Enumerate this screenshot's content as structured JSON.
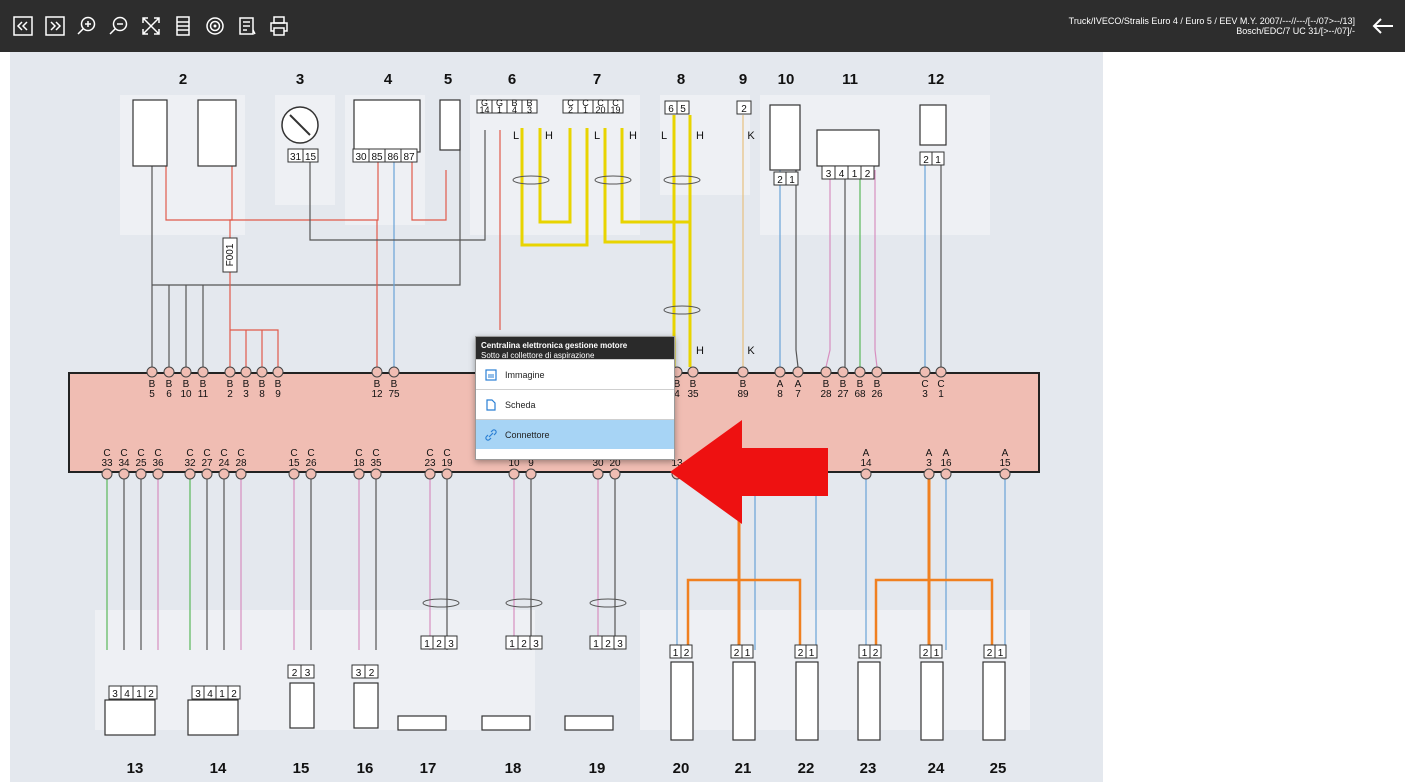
{
  "toolbar": {
    "buttons": [
      "first-page",
      "last-page",
      "zoom-in",
      "zoom-out",
      "fit-screen",
      "list",
      "circuit",
      "notes",
      "print"
    ],
    "vehicle_line1": "Truck/IVECO/Stralis Euro 4 / Euro 5 / EEV M.Y. 2007/---//---/[--/07>--/13]",
    "vehicle_line2": "Bosch/EDC/7 UC 31/[>--/07]/-"
  },
  "diagram": {
    "top_numbers": [
      "2",
      "3",
      "4",
      "5",
      "6",
      "7",
      "8",
      "9",
      "10",
      "11",
      "12"
    ],
    "bottom_numbers": [
      "13",
      "14",
      "15",
      "16",
      "17",
      "18",
      "19",
      "20",
      "21",
      "22",
      "23",
      "24",
      "25"
    ],
    "fuse_label": "F001",
    "wire_letters": [
      "L",
      "H",
      "L",
      "H",
      "L",
      "H",
      "K",
      "H",
      "K"
    ],
    "top_pins": [
      {
        "top": "B",
        "bot": "5"
      },
      {
        "top": "B",
        "bot": "6"
      },
      {
        "top": "B",
        "bot": "10"
      },
      {
        "top": "B",
        "bot": "11"
      },
      {
        "top": "B",
        "bot": "2"
      },
      {
        "top": "B",
        "bot": "3"
      },
      {
        "top": "B",
        "bot": "8"
      },
      {
        "top": "B",
        "bot": "9"
      },
      {
        "top": "B",
        "bot": "12"
      },
      {
        "top": "B",
        "bot": "75"
      },
      {
        "top": "B",
        "bot": "4"
      },
      {
        "top": "B",
        "bot": "35"
      },
      {
        "top": "B",
        "bot": "89"
      },
      {
        "top": "A",
        "bot": "8"
      },
      {
        "top": "A",
        "bot": "7"
      },
      {
        "top": "B",
        "bot": "28"
      },
      {
        "top": "B",
        "bot": "27"
      },
      {
        "top": "B",
        "bot": "68"
      },
      {
        "top": "B",
        "bot": "26"
      },
      {
        "top": "C",
        "bot": "3"
      },
      {
        "top": "C",
        "bot": "1"
      }
    ],
    "bottom_pins": [
      {
        "top": "C",
        "bot": "33"
      },
      {
        "top": "C",
        "bot": "34"
      },
      {
        "top": "C",
        "bot": "25"
      },
      {
        "top": "C",
        "bot": "36"
      },
      {
        "top": "C",
        "bot": "32"
      },
      {
        "top": "C",
        "bot": "27"
      },
      {
        "top": "C",
        "bot": "24"
      },
      {
        "top": "C",
        "bot": "28"
      },
      {
        "top": "C",
        "bot": "15"
      },
      {
        "top": "C",
        "bot": "26"
      },
      {
        "top": "C",
        "bot": "18"
      },
      {
        "top": "C",
        "bot": "35"
      },
      {
        "top": "C",
        "bot": "23"
      },
      {
        "top": "C",
        "bot": "19"
      },
      {
        "top": "",
        "bot": "10"
      },
      {
        "top": "",
        "bot": "9"
      },
      {
        "top": "",
        "bot": "30"
      },
      {
        "top": "",
        "bot": "20"
      },
      {
        "top": "",
        "bot": "13"
      },
      {
        "top": "A",
        "bot": "14"
      },
      {
        "top": "A",
        "bot": "3"
      },
      {
        "top": "A",
        "bot": "16"
      },
      {
        "top": "A",
        "bot": "15"
      }
    ],
    "connector_top_labels": {
      "c3": [
        "31",
        "15"
      ],
      "c4": [
        "30",
        "85",
        "86",
        "87"
      ],
      "c6": [
        "G 14",
        "G 1",
        "B 4",
        "B 3"
      ],
      "c7": [
        "C 2",
        "C 1",
        "C 20",
        "C 19"
      ],
      "c8": [
        "6",
        "5"
      ],
      "c9": [
        "2"
      ],
      "c10": [
        "2",
        "1"
      ],
      "c11": [
        "3",
        "4",
        "1",
        "2"
      ],
      "c12": [
        "2",
        "1"
      ]
    },
    "connector_bottom_labels": {
      "c13": [
        "3",
        "4",
        "1",
        "2"
      ],
      "c14": [
        "3",
        "4",
        "1",
        "2"
      ],
      "c15": [
        "2",
        "3"
      ],
      "c16": [
        "3",
        "2"
      ],
      "c17": [
        "1",
        "2",
        "3"
      ],
      "c18": [
        "1",
        "2",
        "3"
      ],
      "c19": [
        "1",
        "2",
        "3"
      ],
      "c20": [
        "1",
        "2"
      ],
      "c21": [
        "2",
        "1"
      ],
      "c22": [
        "2",
        "1"
      ],
      "c23": [
        "1",
        "2"
      ],
      "c24": [
        "2",
        "1"
      ],
      "c25": [
        "2",
        "1"
      ]
    },
    "colors": {
      "ecu_fill": "#f0bdb3",
      "wire_red": "#e05a4a",
      "wire_blue": "#6aa3d8",
      "wire_yellow": "#e8d400",
      "wire_orange": "#f08020",
      "wire_pink": "#d88fc0",
      "wire_green": "#5ab85a",
      "arrow": "#ee1111"
    }
  },
  "popup": {
    "title": "Centralina elettronica gestione motore",
    "subtitle": "Sotto al collettore di aspirazione",
    "items": [
      {
        "label": "Immagine",
        "icon": "image-icon"
      },
      {
        "label": "Scheda",
        "icon": "document-icon"
      },
      {
        "label": "Connettore",
        "icon": "link-icon"
      }
    ]
  }
}
